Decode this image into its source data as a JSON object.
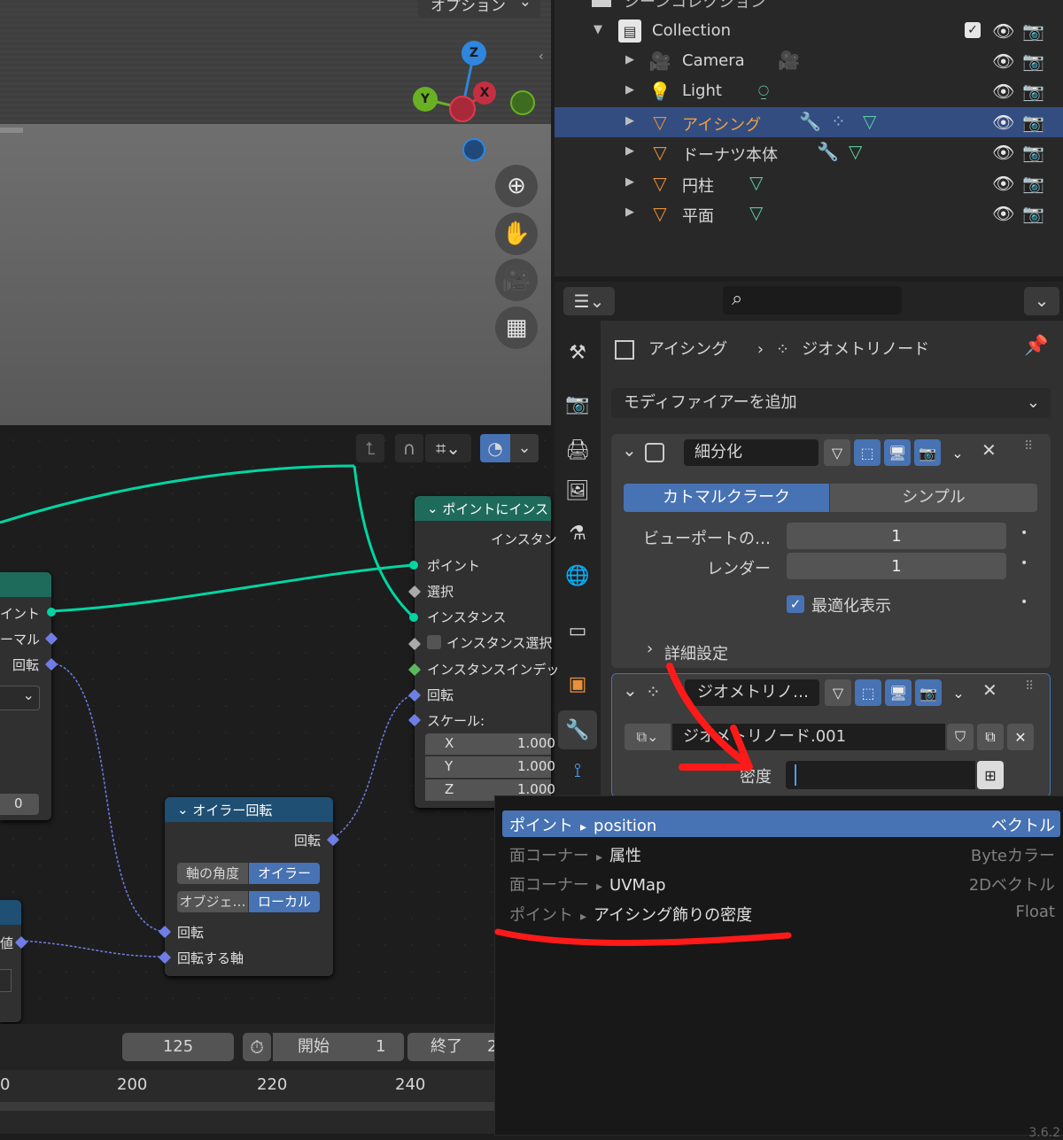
{
  "viewport": {
    "options_label": "オプション",
    "axes": {
      "z": "Z",
      "y": "Y",
      "x": "X"
    }
  },
  "outliner": {
    "header_partial": "シーンコレクション",
    "collection": "Collection",
    "items": [
      {
        "label": "Camera",
        "icon": "camera-icon"
      },
      {
        "label": "Light",
        "icon": "light-icon"
      },
      {
        "label": "アイシング",
        "icon": "mesh-icon",
        "selected": true
      },
      {
        "label": "ドーナツ本体",
        "icon": "mesh-icon"
      },
      {
        "label": "円柱",
        "icon": "mesh-icon"
      },
      {
        "label": "平面",
        "icon": "mesh-icon"
      }
    ]
  },
  "properties": {
    "breadcrumb": {
      "object": "アイシング",
      "modifier": "ジオメトリノード"
    },
    "add_modifier": "モディファイアーを追加",
    "subdivision": {
      "name": "細分化",
      "tab_catmull": "カトマルクラーク",
      "tab_simple": "シンプル",
      "viewport_label": "ビューポートの…",
      "viewport_value": "1",
      "render_label": "レンダー",
      "render_value": "1",
      "optimal_label": "最適化表示",
      "advanced_label": "詳細設定"
    },
    "geonodes": {
      "name": "ジオメトリノ…",
      "nodegroup": "ジオメトリノード.001",
      "density_label": "密度"
    }
  },
  "nodes": {
    "instance_on_points": {
      "title": "ポイントにインス",
      "out_instances": "インスタン",
      "in_points": "ポイント",
      "in_selection": "選択",
      "in_instance": "インスタンス",
      "in_instance_select": "インスタンス選択",
      "in_instance_index": "インスタンスインデッ",
      "in_rotation": "回転",
      "in_scale": "スケール:",
      "x_label": "X",
      "x_value": "1.000",
      "y_label": "Y",
      "y_value": "1.000",
      "z_label": "Z",
      "z_value": "1.000"
    },
    "left_node": {
      "out_point": "イント",
      "out_normal": "ーマル",
      "out_rotation": "回転",
      "value": "0"
    },
    "euler": {
      "title": "オイラー回転",
      "out_rotation": "回転",
      "btn_axis_angle": "軸の角度",
      "btn_euler": "オイラー",
      "btn_object": "オブジェ…",
      "btn_local": "ローカル",
      "in_rotation": "回転",
      "in_axis": "回転する軸"
    },
    "left_bottom": {
      "label": "値"
    }
  },
  "timeline": {
    "current_frame": "125",
    "start_label": "開始",
    "start_value": "1",
    "end_label": "終了",
    "end_value": "2",
    "ticks": [
      "0",
      "200",
      "220",
      "240"
    ]
  },
  "dropdown": {
    "items": [
      {
        "domain": "ポイント",
        "name": "position",
        "type": "ベクトル",
        "selected": true
      },
      {
        "domain": "面コーナー",
        "name": "属性",
        "type": "Byteカラー"
      },
      {
        "domain": "面コーナー",
        "name": "UVMap",
        "type": "2Dベクトル"
      },
      {
        "domain": "ポイント",
        "name": "アイシング飾りの密度",
        "type": "Float"
      }
    ],
    "arrow_glyph": "▸",
    "version": "3.6.2"
  },
  "colors": {
    "accent": "#4772b3",
    "selected_row": "#334d80",
    "node_header_green": "#1e6b5b",
    "node_header_blue": "#1f4f73",
    "annotation_red": "#ff1a1a"
  }
}
